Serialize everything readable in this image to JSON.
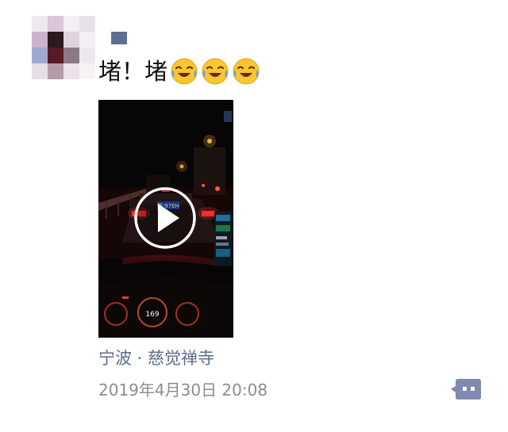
{
  "post": {
    "text": "堵！堵",
    "emojis": [
      "crying-laughing-face",
      "crying-laughing-face",
      "crying-laughing-face"
    ],
    "video": {
      "plate": "浙·97EH",
      "dash_speed": "169"
    },
    "location": "宁波 · 慈觉禅寺",
    "timestamp": "2019年4月30日 20:08"
  },
  "colors": {
    "link": "#5c6b8f",
    "timestamp": "#8c8c8c",
    "comment_button": "#7f8ab0",
    "username_block": "#5f6f94"
  },
  "icons": {
    "play": "play-icon",
    "comment": "comment-icon",
    "emoji": "crying-laughing-emoji-icon"
  }
}
